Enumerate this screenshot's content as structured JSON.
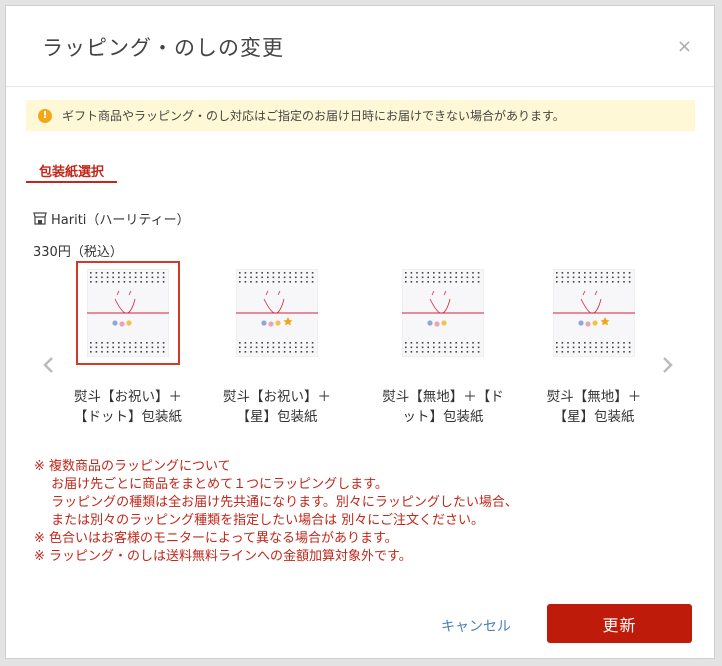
{
  "modal": {
    "title": "ラッピング・のしの変更",
    "close": "×"
  },
  "notice": {
    "icon": "info-icon",
    "text": "ギフト商品やラッピング・のし対応はご指定のお届け日時にお届けできない場合があります。"
  },
  "tab": {
    "label": "包装紙選択"
  },
  "shop": {
    "icon": "shop-icon",
    "name": "Hariti（ハーリティー）"
  },
  "price": "330円（税込）",
  "products": [
    {
      "line1": "熨斗【お祝い】＋",
      "line2": "【ドット】包装紙",
      "selected": true
    },
    {
      "line1": "熨斗【お祝い】＋",
      "line2": "【星】包装紙",
      "selected": false
    },
    {
      "line1": "熨斗【無地】＋【ド",
      "line2": "ット】包装紙",
      "selected": false
    },
    {
      "line1": "熨斗【無地】＋",
      "line2": "【星】包装紙",
      "selected": false
    }
  ],
  "notes": [
    "※ 複数商品のラッピングについて",
    "　 お届け先ごとに商品をまとめて１つにラッピングします。",
    "　 ラッピングの種類は全お届け先共通になります。別々にラッピングしたい場合、",
    "　 または別々のラッピング種類を指定したい場合は 別々にご注文ください。",
    "※ 色合いはお客様のモニターによって異なる場合があります。",
    "※ ラッピング・のしは送料無料ラインへの金額加算対象外です。"
  ],
  "actions": {
    "cancel": "キャンセル",
    "update": "更新"
  },
  "colors": {
    "accent": "#bf1b0b",
    "notice_bg": "#fff8d6",
    "link": "#4a7fc1"
  }
}
